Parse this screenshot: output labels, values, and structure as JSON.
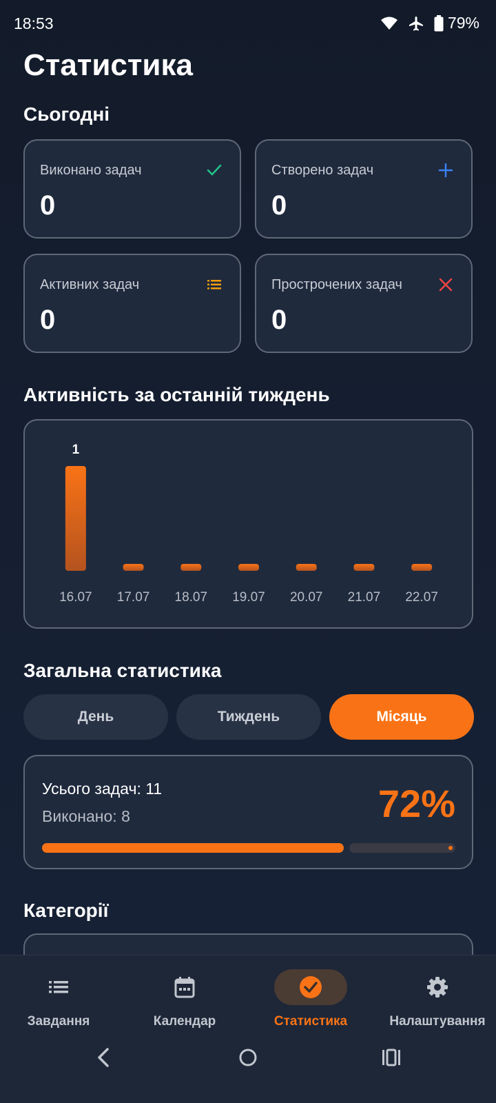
{
  "status_bar": {
    "time": "18:53",
    "battery": "79%"
  },
  "page": {
    "title": "Статистика"
  },
  "today": {
    "title": "Сьогодні",
    "cards": [
      {
        "label": "Виконано задач",
        "value": "0",
        "icon": "check-icon",
        "color": "#22c58b"
      },
      {
        "label": "Створено задач",
        "value": "0",
        "icon": "plus-icon",
        "color": "#3b82f6"
      },
      {
        "label": "Активних задач",
        "value": "0",
        "icon": "list-icon",
        "color": "#f59e0b"
      },
      {
        "label": "Прострочених задач",
        "value": "0",
        "icon": "close-icon",
        "color": "#ef4444"
      }
    ]
  },
  "weekly": {
    "title": "Активність за останній тиждень"
  },
  "chart_data": {
    "type": "bar",
    "categories": [
      "16.07",
      "17.07",
      "18.07",
      "19.07",
      "20.07",
      "21.07",
      "22.07"
    ],
    "values": [
      1,
      0,
      0,
      0,
      0,
      0,
      0
    ],
    "data_labels": [
      "1",
      "",
      "",
      "",
      "",
      "",
      ""
    ],
    "bar_color": "#f97316",
    "ylim": [
      0,
      1
    ],
    "grid": false
  },
  "overall": {
    "title": "Загальна статистика",
    "tabs": [
      "День",
      "Тиждень",
      "Місяць"
    ],
    "active_tab": 2,
    "total_text": "Усього задач: 11",
    "done_text": "Виконано: 8",
    "percent_text": "72%",
    "progress": 0.73
  },
  "categories": {
    "title": "Категорії"
  },
  "bottom_nav": {
    "items": [
      {
        "label": "Завдання",
        "icon": "list-icon"
      },
      {
        "label": "Календар",
        "icon": "calendar-icon"
      },
      {
        "label": "Статистика",
        "icon": "check-circle-icon"
      },
      {
        "label": "Налаштування",
        "icon": "gear-icon"
      }
    ],
    "active": 2,
    "accent": "#f97316"
  }
}
